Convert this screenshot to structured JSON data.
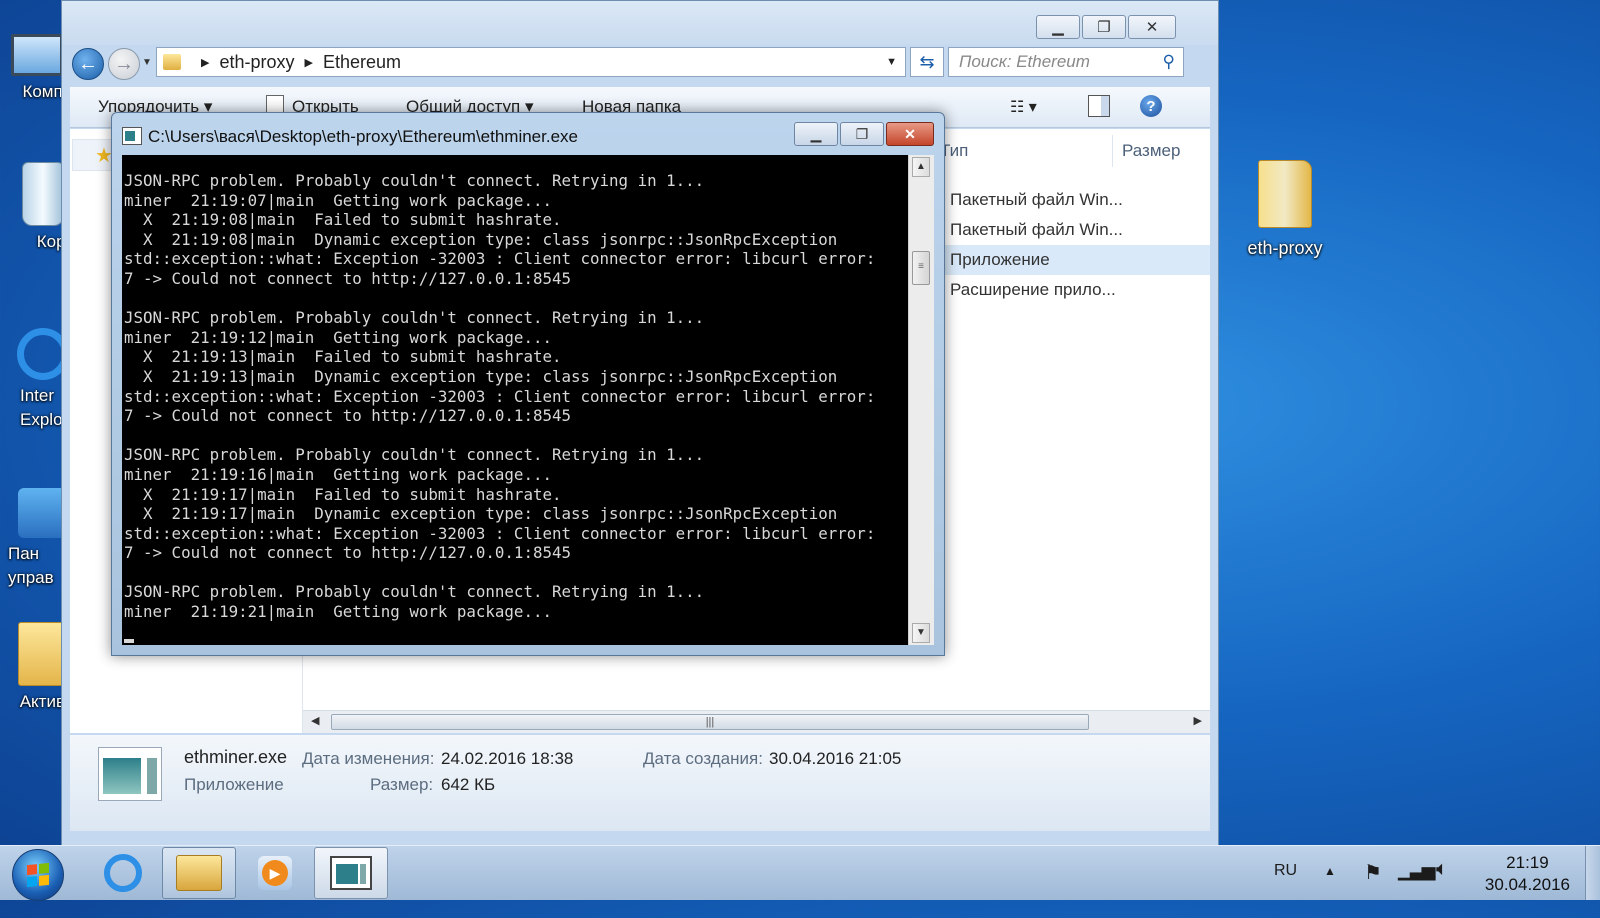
{
  "desktop": {
    "icons_left": [
      {
        "label": "Компь",
        "icon": "computer-icon"
      },
      {
        "label": "Корз",
        "icon": "recycle-bin-icon"
      },
      {
        "label": "Inter Explo",
        "icon": "internet-explorer-icon"
      },
      {
        "label": "Пан управ",
        "icon": "control-panel-icon"
      },
      {
        "label": "Актива",
        "icon": "folder-icon"
      }
    ],
    "icon_right": {
      "label": "eth-proxy",
      "icon": "folder-icon"
    }
  },
  "explorer": {
    "breadcrumb": [
      "eth-proxy",
      "Ethereum"
    ],
    "search_placeholder": "Поиск: Ethereum",
    "toolbar": {
      "organize": "Упорядочить",
      "open": "Открыть",
      "share": "Общий доступ",
      "new_folder": "Новая папка"
    },
    "columns": {
      "type": "Тип",
      "size": "Размер"
    },
    "files": [
      {
        "type": "Пакетный файл Win...",
        "selected": false
      },
      {
        "type": "Пакетный файл Win...",
        "selected": false
      },
      {
        "type": "Приложение",
        "selected": true
      },
      {
        "type": "Расширение прило...",
        "selected": false
      }
    ],
    "details": {
      "name": "ethminer.exe",
      "kind": "Приложение",
      "modified_label": "Дата изменения:",
      "modified": "24.02.2016 18:38",
      "created_label": "Дата создания:",
      "created": "30.04.2016 21:05",
      "size_label": "Размер:",
      "size": "642 КБ"
    }
  },
  "console": {
    "title": "C:\\Users\\вася\\Desktop\\eth-proxy\\Ethereum\\ethminer.exe",
    "output": "JSON-RPC problem. Probably couldn't connect. Retrying in 1...\nminer  21:19:07|main  Getting work package...\n  X  21:19:08|main  Failed to submit hashrate.\n  X  21:19:08|main  Dynamic exception type: class jsonrpc::JsonRpcException\nstd::exception::what: Exception -32003 : Client connector error: libcurl error:\n7 -> Could not connect to http://127.0.0.1:8545\n\nJSON-RPC problem. Probably couldn't connect. Retrying in 1...\nminer  21:19:12|main  Getting work package...\n  X  21:19:13|main  Failed to submit hashrate.\n  X  21:19:13|main  Dynamic exception type: class jsonrpc::JsonRpcException\nstd::exception::what: Exception -32003 : Client connector error: libcurl error:\n7 -> Could not connect to http://127.0.0.1:8545\n\nJSON-RPC problem. Probably couldn't connect. Retrying in 1...\nminer  21:19:16|main  Getting work package...\n  X  21:19:17|main  Failed to submit hashrate.\n  X  21:19:17|main  Dynamic exception type: class jsonrpc::JsonRpcException\nstd::exception::what: Exception -32003 : Client connector error: libcurl error:\n7 -> Could not connect to http://127.0.0.1:8545\n\nJSON-RPC problem. Probably couldn't connect. Retrying in 1...\nminer  21:19:21|main  Getting work package..."
  },
  "taskbar": {
    "language": "RU",
    "time": "21:19",
    "date": "30.04.2016",
    "apps": [
      {
        "name": "internet-explorer",
        "state": "pinned"
      },
      {
        "name": "windows-explorer",
        "state": "running"
      },
      {
        "name": "media-player",
        "state": "pinned"
      },
      {
        "name": "ethminer-console",
        "state": "active"
      }
    ]
  }
}
